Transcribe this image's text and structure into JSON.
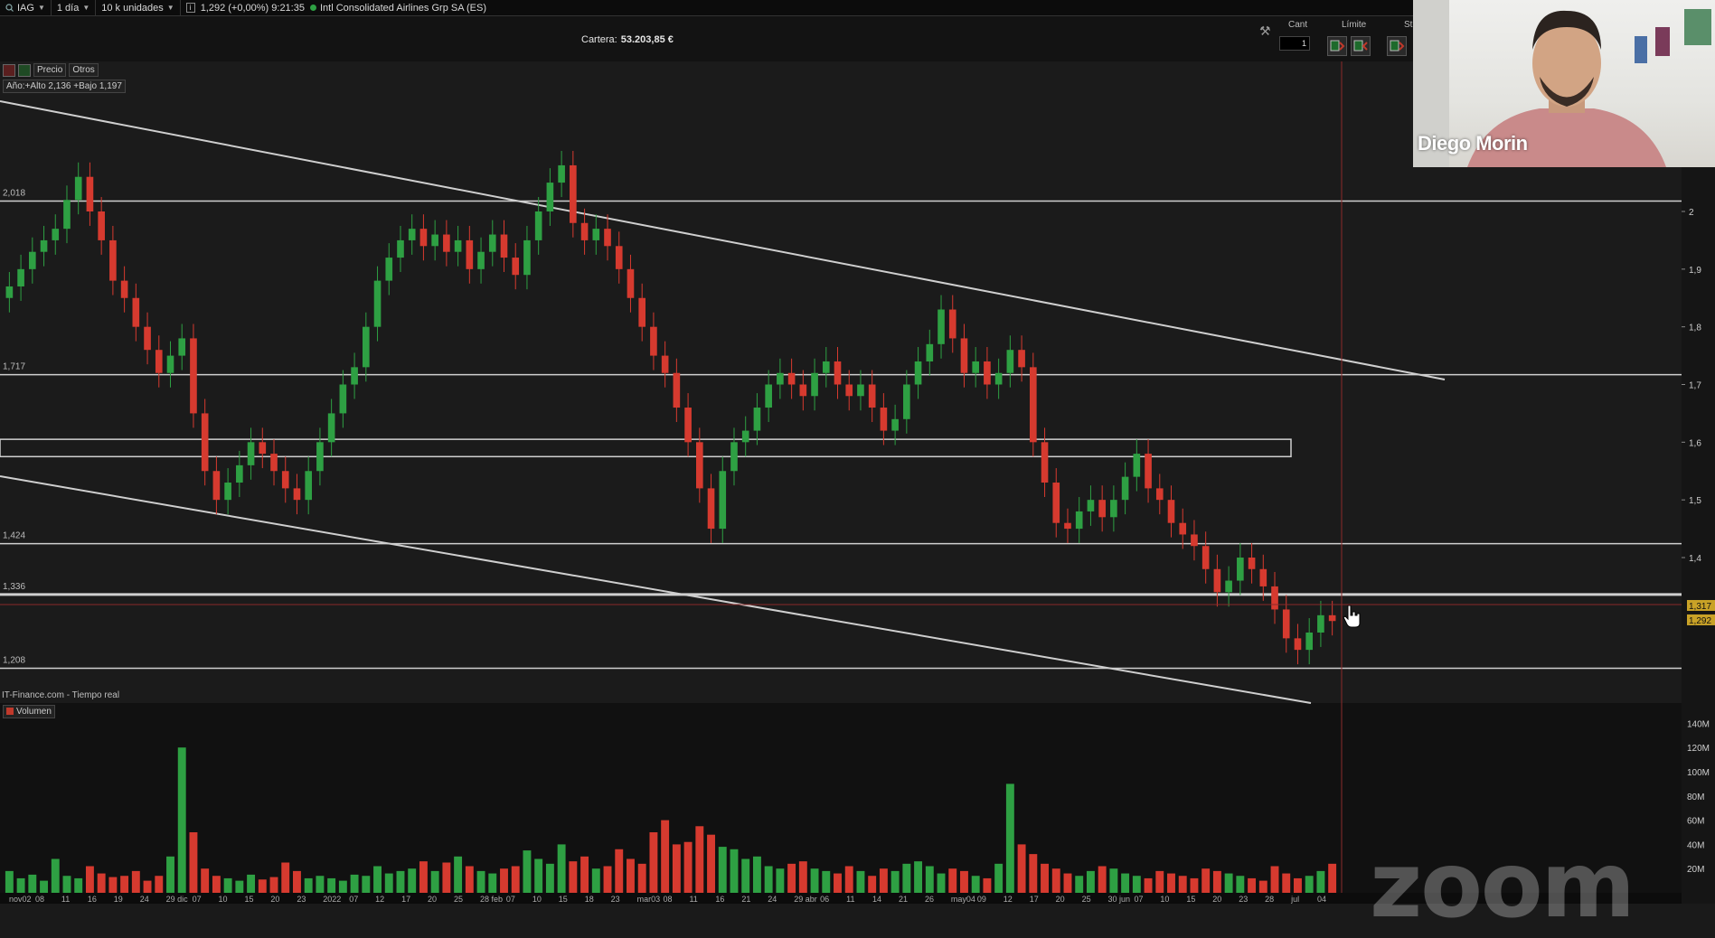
{
  "toolbar": {
    "symbol": "IAG",
    "timeframe": "1 día",
    "units": "10 k unidades",
    "quote": "1,292 (+0,00%) 9:21:35",
    "instrument": "Intl Consolidated Airlines Grp SA (ES)"
  },
  "portfolio": {
    "label": "Cartera:",
    "value": "53.203,85 €"
  },
  "order_panel": {
    "cant_label": "Cant",
    "cant_value": "1",
    "limit_label": "Límite",
    "stop_label": "St"
  },
  "chart_controls": {
    "price_btn": "Precio",
    "others_btn": "Otros",
    "year_info": "Año:+Alto 2,136 +Bajo 1,197"
  },
  "source_label": "IT-Finance.com - Tiempo real",
  "volume_label": "Volumen",
  "webcam": {
    "name": "Diego Morin"
  },
  "watermark": "zoom",
  "chart_data": {
    "type": "candlestick",
    "symbol": "IAG",
    "price_axis": {
      "ticks": [
        "2",
        "1,9",
        "1,8",
        "1,7",
        "1,6",
        "1,5",
        "1,4"
      ],
      "min": 1.15,
      "max": 2.2
    },
    "price_badges": [
      "1,317",
      "1,292"
    ],
    "level_labels": [
      "2,018",
      "1,717",
      "1,424",
      "1,336",
      "1,208"
    ],
    "levels": [
      2.018,
      1.717,
      1.424,
      1.336,
      1.208
    ],
    "zone": [
      1.575,
      1.605
    ],
    "volume_axis": {
      "ticks": [
        "140M",
        "120M",
        "100M",
        "80M",
        "60M",
        "40M",
        "20M"
      ],
      "max": 150
    },
    "x_labels": [
      "nov02",
      "08",
      "11",
      "16",
      "19",
      "24",
      "29 dic",
      "07",
      "10",
      "15",
      "20",
      "23",
      "2022",
      "07",
      "12",
      "17",
      "20",
      "25",
      "28 feb",
      "07",
      "10",
      "15",
      "18",
      "23",
      "mar03",
      "08",
      "11",
      "16",
      "21",
      "24",
      "29 abr",
      "06",
      "11",
      "14",
      "21",
      "26",
      "may04",
      "09",
      "12",
      "17",
      "20",
      "25",
      "30 jun",
      "07",
      "10",
      "15",
      "20",
      "23",
      "28",
      "jul",
      "04"
    ],
    "closes": [
      1.87,
      1.9,
      1.93,
      1.95,
      1.97,
      2.02,
      2.06,
      2.0,
      1.95,
      1.88,
      1.85,
      1.8,
      1.76,
      1.72,
      1.75,
      1.78,
      1.65,
      1.55,
      1.5,
      1.53,
      1.56,
      1.6,
      1.58,
      1.55,
      1.52,
      1.5,
      1.55,
      1.6,
      1.65,
      1.7,
      1.73,
      1.8,
      1.88,
      1.92,
      1.95,
      1.97,
      1.94,
      1.96,
      1.93,
      1.95,
      1.9,
      1.93,
      1.96,
      1.92,
      1.89,
      1.95,
      2.0,
      2.05,
      2.08,
      1.98,
      1.95,
      1.97,
      1.94,
      1.9,
      1.85,
      1.8,
      1.75,
      1.72,
      1.66,
      1.6,
      1.52,
      1.45,
      1.55,
      1.6,
      1.62,
      1.66,
      1.7,
      1.72,
      1.7,
      1.68,
      1.72,
      1.74,
      1.7,
      1.68,
      1.7,
      1.66,
      1.62,
      1.64,
      1.7,
      1.74,
      1.77,
      1.83,
      1.78,
      1.72,
      1.74,
      1.7,
      1.72,
      1.76,
      1.73,
      1.6,
      1.53,
      1.46,
      1.45,
      1.48,
      1.5,
      1.47,
      1.5,
      1.54,
      1.58,
      1.52,
      1.5,
      1.46,
      1.44,
      1.42,
      1.38,
      1.34,
      1.36,
      1.4,
      1.38,
      1.35,
      1.31,
      1.26,
      1.24,
      1.27,
      1.3,
      1.29
    ],
    "volumes_M": [
      18,
      12,
      15,
      10,
      28,
      14,
      12,
      22,
      16,
      13,
      14,
      18,
      10,
      14,
      30,
      120,
      50,
      20,
      14,
      12,
      10,
      15,
      11,
      13,
      25,
      18,
      12,
      14,
      12,
      10,
      15,
      14,
      22,
      16,
      18,
      20,
      26,
      18,
      25,
      30,
      22,
      18,
      16,
      20,
      22,
      35,
      28,
      24,
      40,
      26,
      30,
      20,
      22,
      36,
      28,
      24,
      50,
      60,
      40,
      42,
      55,
      48,
      38,
      36,
      28,
      30,
      22,
      20,
      24,
      26,
      20,
      18,
      16,
      22,
      18,
      14,
      20,
      18,
      24,
      26,
      22,
      16,
      20,
      18,
      14,
      12,
      24,
      90,
      40,
      32,
      24,
      20,
      16,
      14,
      18,
      22,
      20,
      16,
      14,
      12,
      18,
      16,
      14,
      12,
      20,
      18,
      16,
      14,
      12,
      10,
      22,
      16,
      12,
      14,
      18,
      24
    ]
  }
}
